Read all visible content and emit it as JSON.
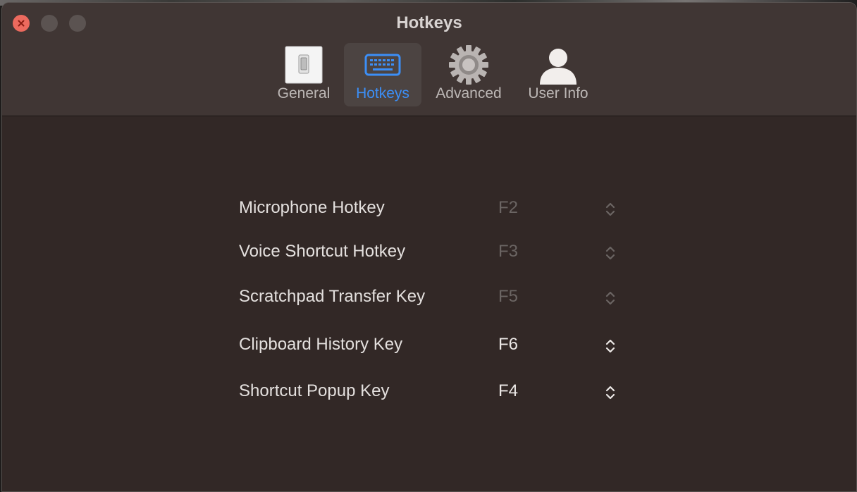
{
  "window": {
    "title": "Hotkeys"
  },
  "toolbar": {
    "tabs": [
      {
        "label": "General",
        "icon": "toggle-switch-icon",
        "active": false
      },
      {
        "label": "Hotkeys",
        "icon": "keyboard-icon",
        "active": true
      },
      {
        "label": "Advanced",
        "icon": "gear-icon",
        "active": false
      },
      {
        "label": "User Info",
        "icon": "person-icon",
        "active": false
      }
    ]
  },
  "hotkeys": [
    {
      "label": "Microphone Hotkey",
      "value": "F2",
      "enabled": false
    },
    {
      "label": "Voice Shortcut Hotkey",
      "value": "F3",
      "enabled": false
    },
    {
      "label": "Scratchpad Transfer Key",
      "value": "F5",
      "enabled": false
    },
    {
      "label": "Clipboard History Key",
      "value": "F6",
      "enabled": true
    },
    {
      "label": "Shortcut Popup Key",
      "value": "F4",
      "enabled": true
    }
  ],
  "colors": {
    "accent": "#3c8ff7",
    "window_bg": "#322826",
    "titlebar_bg": "#403634",
    "close_button": "#ec6a5e"
  }
}
